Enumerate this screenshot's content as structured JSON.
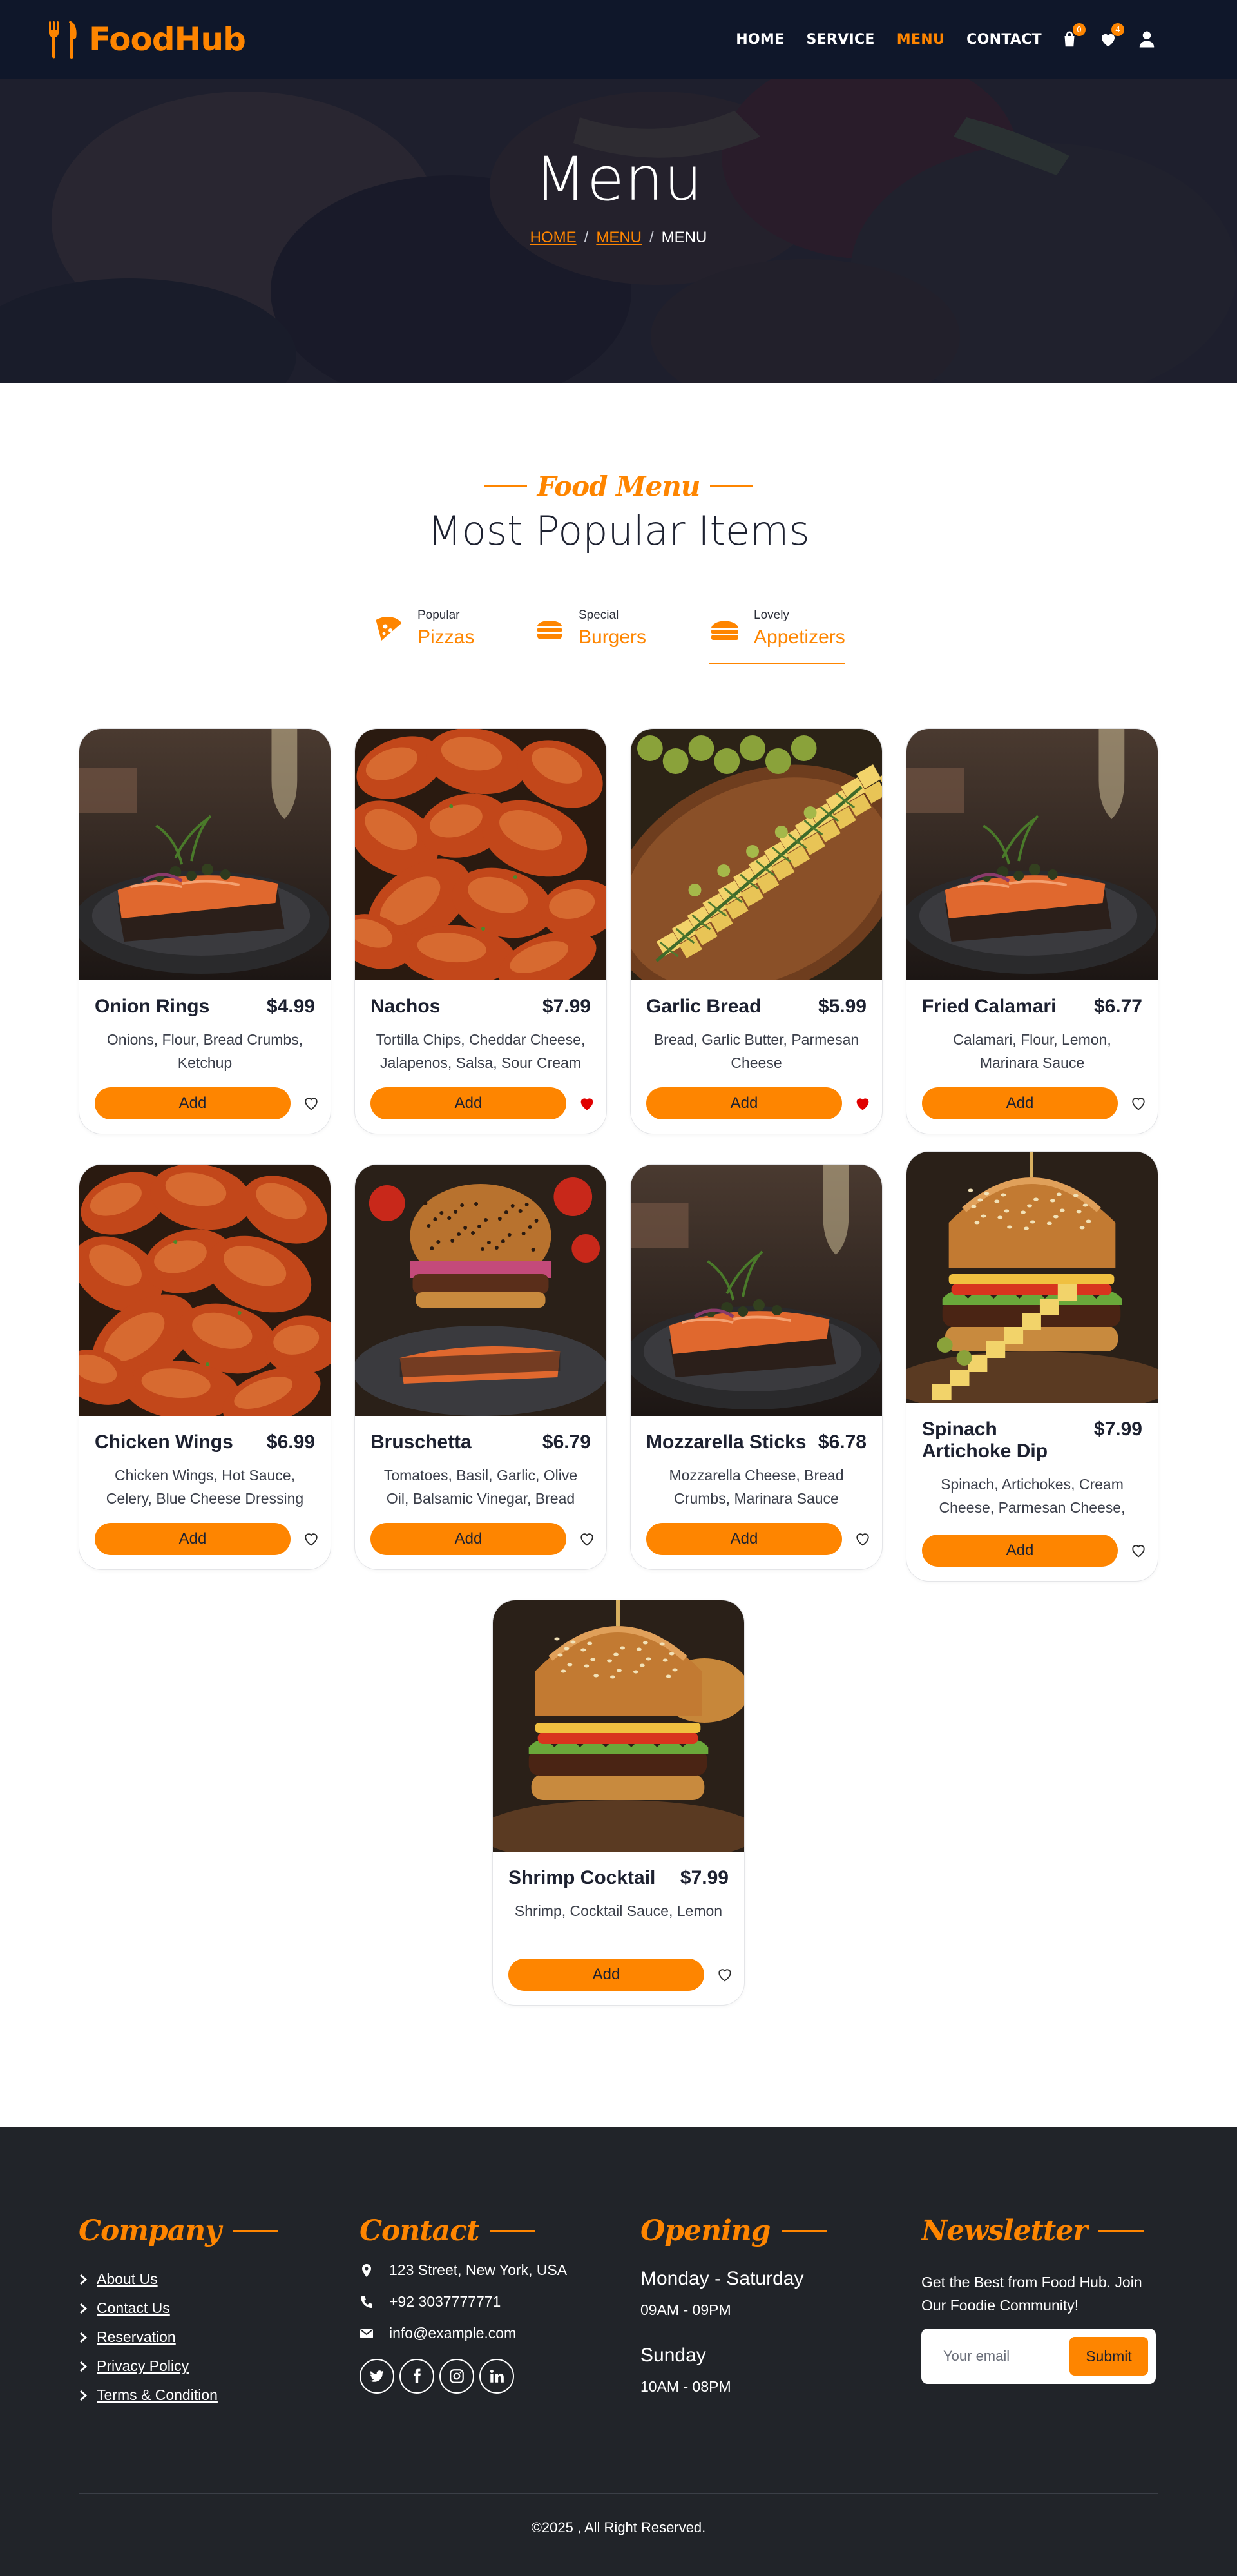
{
  "brand": {
    "name": "FoodHub",
    "accent": "#fe8500"
  },
  "nav": {
    "links": [
      {
        "label": "HOME",
        "active": false
      },
      {
        "label": "SERVICE",
        "active": false
      },
      {
        "label": "MENU",
        "active": true
      },
      {
        "label": "CONTACT",
        "active": false
      }
    ],
    "cart_icon": "bag-icon",
    "cart_count": "0",
    "wishlist_icon": "heart-icon",
    "wishlist_count": "4",
    "user_icon": "user-icon"
  },
  "hero": {
    "title": "Menu",
    "breadcrumb": [
      "HOME",
      "MENU",
      "MENU"
    ]
  },
  "menu": {
    "subtitle": "Food Menu",
    "title": "Most Popular Items",
    "tabs": [
      {
        "small": "Popular",
        "big": "Pizzas",
        "icon": "pizza-icon",
        "active": false
      },
      {
        "small": "Special",
        "big": "Burgers",
        "icon": "burger-icon",
        "active": false
      },
      {
        "small": "Lovely",
        "big": "Appetizers",
        "icon": "sandwich-icon",
        "active": true
      }
    ],
    "add_label": "Add",
    "items": [
      {
        "name": "Onion Rings",
        "price": "$4.99",
        "desc": "Onions, Flour, Bread Crumbs, Ketchup",
        "image": "salmon",
        "favorite": false
      },
      {
        "name": "Nachos",
        "price": "$7.99",
        "desc": "Tortilla Chips, Cheddar Cheese, Jalapenos, Salsa, Sour Cream",
        "image": "chicken",
        "favorite": true
      },
      {
        "name": "Garlic Bread",
        "price": "$5.99",
        "desc": "Bread, Garlic Butter, Parmesan Cheese",
        "image": "cheese",
        "favorite": true
      },
      {
        "name": "Fried Calamari",
        "price": "$6.77",
        "desc": "Calamari, Flour, Lemon, Marinara Sauce",
        "image": "salmon",
        "favorite": false
      },
      {
        "name": "Chicken Wings",
        "price": "$6.99",
        "desc": "Chicken Wings, Hot Sauce, Celery, Blue Cheese Dressing",
        "image": "chicken",
        "favorite": false
      },
      {
        "name": "Bruschetta",
        "price": "$6.79",
        "desc": "Tomatoes, Basil, Garlic, Olive Oil, Balsamic Vinegar, Bread",
        "image": "burger-salmon",
        "favorite": false
      },
      {
        "name": "Mozzarella Sticks",
        "price": "$6.78",
        "desc": "Mozzarella Cheese, Bread Crumbs, Marinara Sauce",
        "image": "salmon",
        "favorite": false
      },
      {
        "name": "Spinach Artichoke Dip",
        "price": "$7.99",
        "desc": "Spinach, Artichokes, Cream Cheese, Parmesan Cheese,",
        "image": "burger-cheese",
        "favorite": false
      },
      {
        "name": "Shrimp Cocktail",
        "price": "$7.99",
        "desc": "Shrimp, Cocktail Sauce, Lemon",
        "image": "burger",
        "favorite": false
      }
    ]
  },
  "footer": {
    "company": {
      "title": "Company",
      "links": [
        "About Us",
        "Contact Us",
        "Reservation",
        "Privacy Policy",
        "Terms & Condition"
      ]
    },
    "contact": {
      "title": "Contact",
      "address": "123 Street, New York, USA",
      "phone": "+92 3037777771",
      "email": "info@example.com",
      "socials": [
        "twitter-icon",
        "facebook-icon",
        "instagram-icon",
        "linkedin-icon"
      ]
    },
    "opening": {
      "title": "Opening",
      "day1": "Monday - Saturday",
      "hours1": "09AM - 09PM",
      "day2": "Sunday",
      "hours2": "10AM - 08PM"
    },
    "newsletter": {
      "title": "Newsletter",
      "text": "Get the Best from Food Hub. Join Our Foodie Community!",
      "placeholder": "Your email",
      "button": "Submit"
    },
    "copyright": "©2025 , All Right Reserved."
  }
}
